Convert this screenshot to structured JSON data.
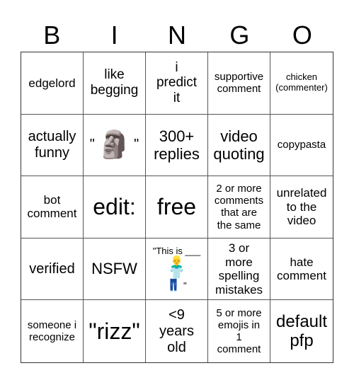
{
  "header": [
    "B",
    "I",
    "N",
    "G",
    "O"
  ],
  "cells": [
    "edgelord",
    "like begging",
    "i predict it",
    "supportive comment",
    "chicken (commenter)",
    "actually funny",
    "\"🗿\"",
    "300+ replies",
    "video quoting",
    "copypasta",
    "bot comment",
    "edit:",
    "free",
    "2 or more comments that are the same",
    "unrelated to the video",
    "verified",
    "NSFW",
    "\"This is ___ 👱‍♂️👕👖\"",
    "3 or more spelling mistakes",
    "hate comment",
    "someone i recognize",
    "\"rizz\"",
    "<9 years old",
    "5 or more emojis in 1 comment",
    "default pfp"
  ],
  "special": {
    "moai": {
      "quote_open": "\"",
      "emoji": "🗿",
      "quote_close": "\""
    },
    "this_is": {
      "text": "\"This is ___",
      "emoji_head": "👱‍♂️",
      "emoji_shirt": "👕",
      "emoji_pants": "👖",
      "quote_close": "\""
    }
  }
}
